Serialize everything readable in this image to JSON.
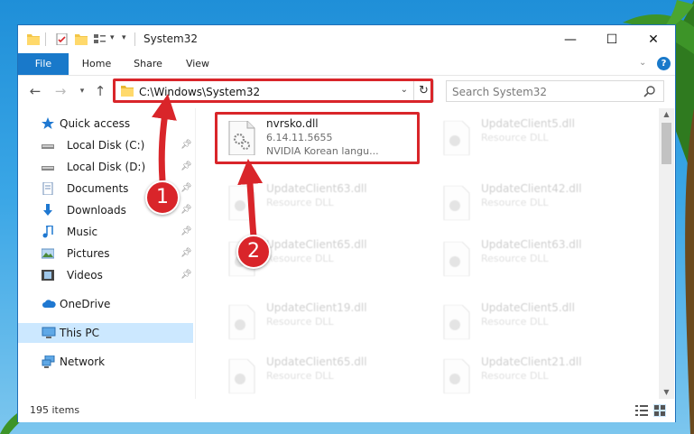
{
  "window": {
    "title": "System32",
    "controls": {
      "minimize": "—",
      "maximize": "☐",
      "close": "✕"
    }
  },
  "ribbon": {
    "tabs": [
      {
        "label": "File"
      },
      {
        "label": "Home"
      },
      {
        "label": "Share"
      },
      {
        "label": "View"
      }
    ],
    "help": "?"
  },
  "address_bar": {
    "path": "C:\\Windows\\System32",
    "search_placeholder": "Search System32"
  },
  "nav_pane": {
    "items": [
      {
        "label": "Quick access",
        "icon": "star-icon"
      },
      {
        "label": "Local Disk (C:)",
        "icon": "drive-icon",
        "pinned": true
      },
      {
        "label": "Local Disk (D:)",
        "icon": "drive-icon",
        "pinned": true
      },
      {
        "label": "Documents",
        "icon": "documents-icon",
        "pinned": true
      },
      {
        "label": "Downloads",
        "icon": "download-icon",
        "pinned": true
      },
      {
        "label": "Music",
        "icon": "music-icon",
        "pinned": true
      },
      {
        "label": "Pictures",
        "icon": "pictures-icon",
        "pinned": true
      },
      {
        "label": "Videos",
        "icon": "videos-icon",
        "pinned": true
      },
      {
        "label": "OneDrive",
        "icon": "cloud-icon"
      },
      {
        "label": "This PC",
        "icon": "computer-icon",
        "selected": true
      },
      {
        "label": "Network",
        "icon": "network-icon"
      }
    ]
  },
  "files": [
    {
      "name": "nvrsko.dll",
      "type": "6.14.11.5655",
      "desc": "NVIDIA Korean langu...",
      "faded": false
    },
    {
      "name": "UpdateClient5.dll",
      "type": "Resource DLL",
      "faded": true
    },
    {
      "name": "UpdateClient63.dll",
      "type": "Resource DLL",
      "faded": true
    },
    {
      "name": "UpdateClient42.dll",
      "type": "Resource DLL",
      "faded": true
    },
    {
      "name": "UpdateClient65.dll",
      "type": "Resource DLL",
      "faded": true
    },
    {
      "name": "UpdateClient63.dll",
      "type": "Resource DLL",
      "faded": true
    },
    {
      "name": "UpdateClient19.dll",
      "type": "Resource DLL",
      "faded": true
    },
    {
      "name": "UpdateClient5.dll",
      "type": "Resource DLL",
      "faded": true
    },
    {
      "name": "UpdateClient65.dll",
      "type": "Resource DLL",
      "faded": true
    },
    {
      "name": "UpdateClient21.dll",
      "type": "Resource DLL",
      "faded": true
    }
  ],
  "status": {
    "item_count": "195 items"
  },
  "annotations": {
    "marker_1": "1",
    "marker_2": "2",
    "color": "#d9252a"
  },
  "colors": {
    "accent": "#1979ca",
    "selection": "#cce8ff",
    "highlight": "#d9252a"
  }
}
